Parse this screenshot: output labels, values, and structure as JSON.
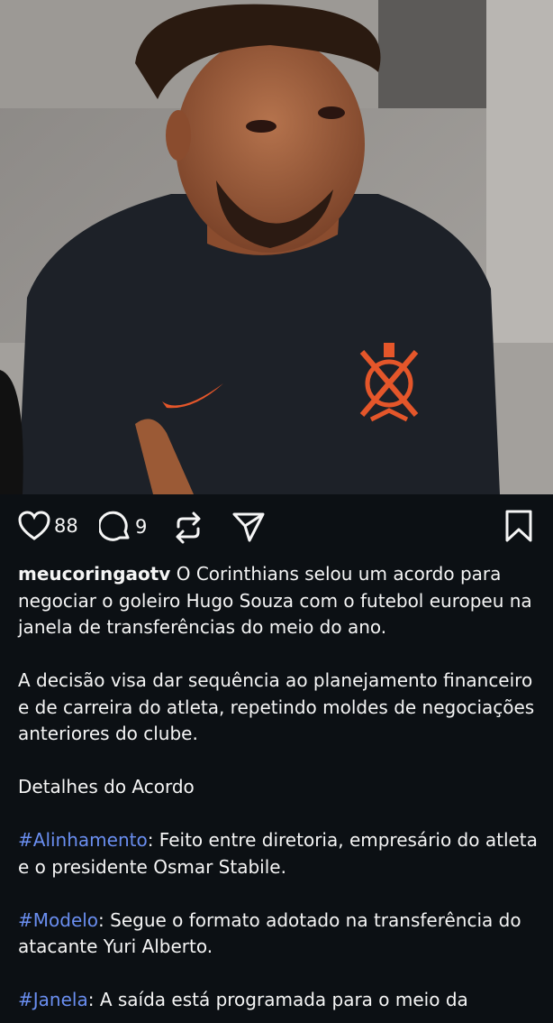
{
  "post": {
    "image_alt_icon": "photo",
    "likes": "88",
    "comments": "9"
  },
  "caption": {
    "username": "meucoringaotv",
    "intro": " O Corinthians selou um acordo para negociar o goleiro Hugo Souza com o futebol europeu na janela de transferências do meio do ano.",
    "paragraph2": "A decisão visa dar sequência ao planejamento financeiro e de carreira do atleta, repetindo moldes de negociações anteriores do clube.",
    "heading": "Detalhes do Acordo",
    "items": [
      {
        "tag": "#Alinhamento",
        "text": ": Feito entre diretoria, empresário do atleta e o presidente Osmar Stabile."
      },
      {
        "tag": "#Modelo",
        "text": ": Segue o formato adotado na transferência do atacante Yuri Alberto."
      },
      {
        "tag": "#Janela",
        "text": ": A saída está programada para o meio da"
      }
    ]
  },
  "colors": {
    "background": "#0c1014",
    "hashtag": "#6a8ef0",
    "text": "#f5f5f5"
  }
}
